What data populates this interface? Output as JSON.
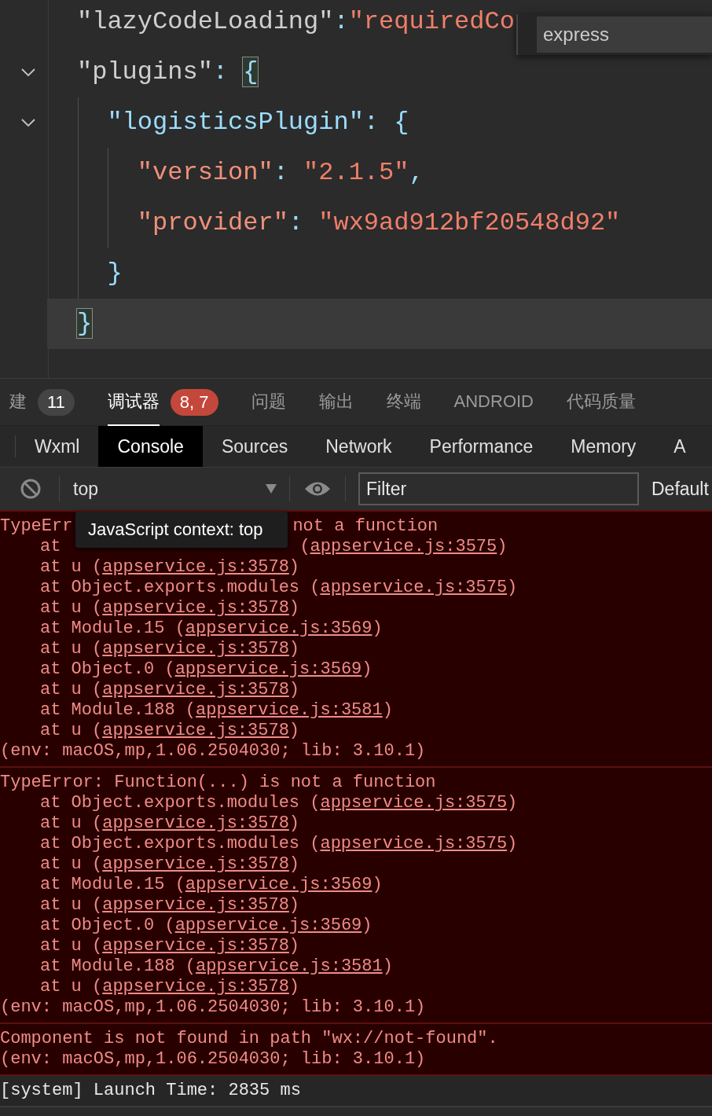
{
  "editor": {
    "lines": [
      {
        "current": false,
        "foldable": false,
        "tokens": [
          {
            "kind": "key",
            "text": "\"lazyCodeLoading\""
          },
          {
            "kind": "punct",
            "text": ":"
          },
          {
            "kind": "string",
            "text": "\"requiredCo"
          }
        ]
      },
      {
        "current": false,
        "foldable": true,
        "tokens": [
          {
            "kind": "key",
            "text": "\"plugins\""
          },
          {
            "kind": "punct",
            "text": ": "
          },
          {
            "kind": "bracket",
            "text": "{",
            "matched": true
          }
        ]
      },
      {
        "current": false,
        "foldable": true,
        "tokens": [
          {
            "kind": "key2",
            "text": "  \"logisticsPlugin\""
          },
          {
            "kind": "punct",
            "text": ": "
          },
          {
            "kind": "bracket",
            "text": "{",
            "matched": false
          }
        ]
      },
      {
        "current": false,
        "foldable": false,
        "tokens": [
          {
            "kind": "key3",
            "text": "    \"version\""
          },
          {
            "kind": "punct",
            "text": ": "
          },
          {
            "kind": "string",
            "text": "\"2.1.5\""
          },
          {
            "kind": "punct",
            "text": ","
          }
        ]
      },
      {
        "current": false,
        "foldable": false,
        "tokens": [
          {
            "kind": "key3",
            "text": "    \"provider\""
          },
          {
            "kind": "punct",
            "text": ": "
          },
          {
            "kind": "string",
            "text": "\"wx9ad912bf20548d92\""
          }
        ]
      },
      {
        "current": false,
        "foldable": false,
        "tokens": [
          {
            "kind": "bracket",
            "text": "  }",
            "matched": false
          }
        ]
      },
      {
        "current": true,
        "foldable": false,
        "tokens": [
          {
            "kind": "bracket",
            "text": "}",
            "matched": true
          }
        ]
      }
    ],
    "find_widget": {
      "value": "express"
    }
  },
  "panel_tabs": [
    {
      "label": "建",
      "badge": "11",
      "color": "#444444",
      "selected": false
    },
    {
      "label": "调试器",
      "badge": "8, 7",
      "color": "#c4473b",
      "selected": true
    },
    {
      "label": "问题",
      "selected": false
    },
    {
      "label": "输出",
      "selected": false
    },
    {
      "label": "终端",
      "selected": false
    },
    {
      "label": "ANDROID",
      "selected": false
    },
    {
      "label": "代码质量",
      "selected": false
    }
  ],
  "devtools_tabs": [
    {
      "label": "Wxml",
      "selected": false
    },
    {
      "label": "Console",
      "selected": true
    },
    {
      "label": "Sources",
      "selected": false
    },
    {
      "label": "Network",
      "selected": false
    },
    {
      "label": "Performance",
      "selected": false
    },
    {
      "label": "Memory",
      "selected": false
    },
    {
      "label": "A",
      "selected": false
    }
  ],
  "toolbar": {
    "context": "top",
    "filter_placeholder": "Filter",
    "levels": "Default"
  },
  "tooltip": "JavaScript context: top",
  "messages": [
    {
      "kind": "error",
      "message": [
        "TypeErr",
        "not a function"
      ],
      "frames": [
        {
          "text": "at",
          "open": "(",
          "link": "appservice.js:3575",
          "end": ")"
        },
        {
          "text": "at u (",
          "link": "appservice.js:3578",
          "end": ")"
        },
        {
          "text": "at Object.exports.modules (",
          "link": "appservice.js:3575",
          "end": ")"
        },
        {
          "text": "at u (",
          "link": "appservice.js:3578",
          "end": ")"
        },
        {
          "text": "at Module.15 (",
          "link": "appservice.js:3569",
          "end": ")"
        },
        {
          "text": "at u (",
          "link": "appservice.js:3578",
          "end": ")"
        },
        {
          "text": "at Object.0 (",
          "link": "appservice.js:3569",
          "end": ")"
        },
        {
          "text": "at u (",
          "link": "appservice.js:3578",
          "end": ")"
        },
        {
          "text": "at Module.188 (",
          "link": "appservice.js:3581",
          "end": ")"
        },
        {
          "text": "at u (",
          "link": "appservice.js:3578",
          "end": ")"
        }
      ],
      "env": "(env: macOS,mp,1.06.2504030; lib: 3.10.1)"
    },
    {
      "kind": "error",
      "message": [
        "TypeError: Function(...) is not a function"
      ],
      "frames": [
        {
          "text": "at Object.exports.modules (",
          "link": "appservice.js:3575",
          "end": ")"
        },
        {
          "text": "at u (",
          "link": "appservice.js:3578",
          "end": ")"
        },
        {
          "text": "at Object.exports.modules (",
          "link": "appservice.js:3575",
          "end": ")"
        },
        {
          "text": "at u (",
          "link": "appservice.js:3578",
          "end": ")"
        },
        {
          "text": "at Module.15 (",
          "link": "appservice.js:3569",
          "end": ")"
        },
        {
          "text": "at u (",
          "link": "appservice.js:3578",
          "end": ")"
        },
        {
          "text": "at Object.0 (",
          "link": "appservice.js:3569",
          "end": ")"
        },
        {
          "text": "at u (",
          "link": "appservice.js:3578",
          "end": ")"
        },
        {
          "text": "at Module.188 (",
          "link": "appservice.js:3581",
          "end": ")"
        },
        {
          "text": "at u (",
          "link": "appservice.js:3578",
          "end": ")"
        }
      ],
      "env": "(env: macOS,mp,1.06.2504030; lib: 3.10.1)"
    },
    {
      "kind": "error",
      "message": [
        "Component is not found in path \"wx://not-found\"."
      ],
      "env": "(env: macOS,mp,1.06.2504030; lib: 3.10.1)"
    },
    {
      "kind": "log",
      "message": [
        "[system] Launch Time: 2835 ms"
      ]
    }
  ]
}
